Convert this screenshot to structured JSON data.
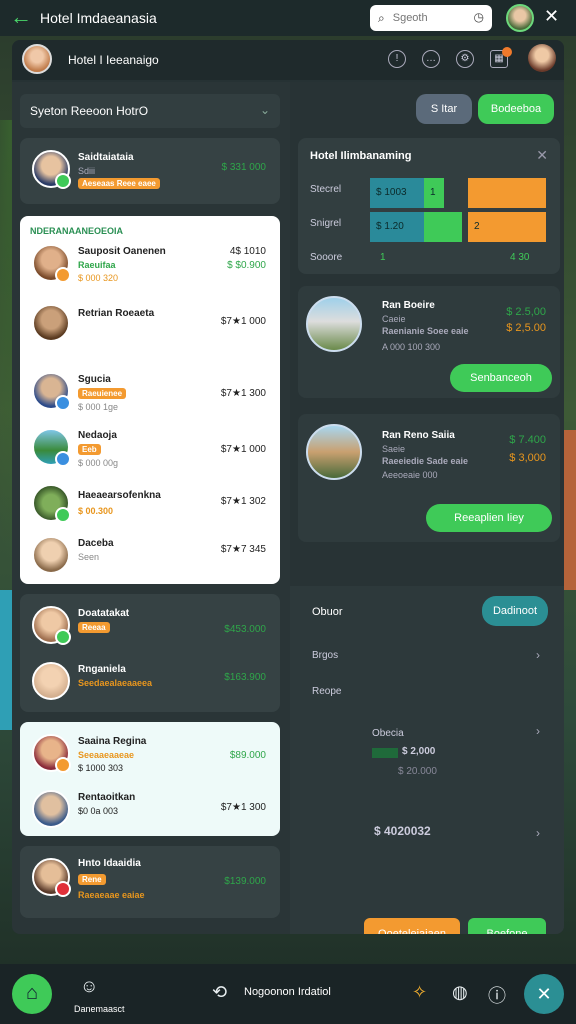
{
  "app": {
    "title": "Hotel Imdaeanasia"
  },
  "search": {
    "placeholder": "Sgeoth"
  },
  "header": {
    "hotel_name": "Hotel I Ieeanaigo"
  },
  "filter": {
    "selected": "Syeton Reeoon  HotrO"
  },
  "sidebar_cards": {
    "top": {
      "name": "Saidtaiataia",
      "sub": "Sdiii",
      "tag": "Aeseaas Reee eaee",
      "price": "$ 331 000"
    },
    "section_label": "NDERANAANEOEOIA",
    "group1": [
      {
        "name": "Sauposit Oanenen",
        "tag": "Raeuifaa",
        "sub": "$ 000 320",
        "price_a": "4$ 1010",
        "price_b": "$ $0.900"
      },
      {
        "name": "Retrian Roeaeta",
        "sub": "",
        "price_a": "$7★1 000"
      },
      {
        "name": "Sgucia",
        "tag": "Raeuienee",
        "sub": "$ 000 1ge",
        "price_a": "$7★1 300"
      },
      {
        "name": "Nedaoja",
        "tag": "Eeb",
        "sub": "$ 000 00g",
        "price_a": "$7★1 000"
      },
      {
        "name": "Haeaearsofenkna",
        "sub": "$ 00.300",
        "price_a": "$7★1 302"
      },
      {
        "name": "Daceba",
        "sub": "Seen",
        "price_a": "$7★7 345"
      }
    ],
    "group2": [
      {
        "name": "Doatatakat",
        "tag": "Reeaa",
        "price_a": "$453.000"
      },
      {
        "name": "Rnganiela",
        "tag": "Seedaealaeaaeea",
        "price_a": "$163.900"
      }
    ],
    "group3": [
      {
        "name": "Saaina Regina",
        "tag": "Seeaaeaaeae",
        "sub": "$ 1000 303",
        "price_a": "$89.000"
      },
      {
        "name": "Rentaoitkan",
        "sub": "$0 0a 003",
        "price_a": "$7★1 300"
      }
    ],
    "group4": [
      {
        "name": "Hnto Idaaidia",
        "tag": "Rene",
        "sub": "Raeaeaae eaiae",
        "price_a": "$139.000"
      }
    ]
  },
  "actions": {
    "filter_btn": "S Itar",
    "book_btn": "Bodeeboa"
  },
  "bench_panel": {
    "title": "Hotel Ilimbanaming",
    "rows": [
      {
        "label": "Stecrel",
        "val_a": "$ 1003",
        "val_b": "1"
      },
      {
        "label": "Snigrel",
        "val_a": "$ 1.20",
        "val_b": "2"
      },
      {
        "label": "Sooore",
        "val_a": "1",
        "val_b": "4 30"
      }
    ]
  },
  "hotels": [
    {
      "name": "Ran Boeire",
      "sub": "Caeie",
      "sub2": "Raenianie Soee eaie",
      "sub3": "A 000 100 300",
      "price": "$ 2.5,00",
      "price2": "$ 2,5.00",
      "cta": "Senbanceoh"
    },
    {
      "name": "Ran Reno Saiia",
      "sub": "Saeie",
      "sub2": "Raeeiedie Sade eaie",
      "sub3": "Aeeoeaie 000",
      "price": "$ 7.400",
      "price2": "$ 3,000",
      "cta": "Reeaplien Iiey"
    }
  ],
  "lower": {
    "title": "Obuor",
    "action": "Dadinoot",
    "rows": [
      "Brgos",
      "Reope"
    ],
    "stat_label": "Obecia",
    "stat_a": "$ 2,000",
    "stat_b": "$ 20.000",
    "total": "$ 4020032",
    "btn_a": "Ooeteleiaiaen",
    "btn_b": "Boefone"
  },
  "bottom_nav": {
    "dashboard_label": "Danemaasct",
    "center_label": "Nogoonon Irdatiol"
  },
  "colors": {
    "accent": "#3fca58",
    "orange": "#f39a30",
    "teal": "#2b8f94"
  }
}
